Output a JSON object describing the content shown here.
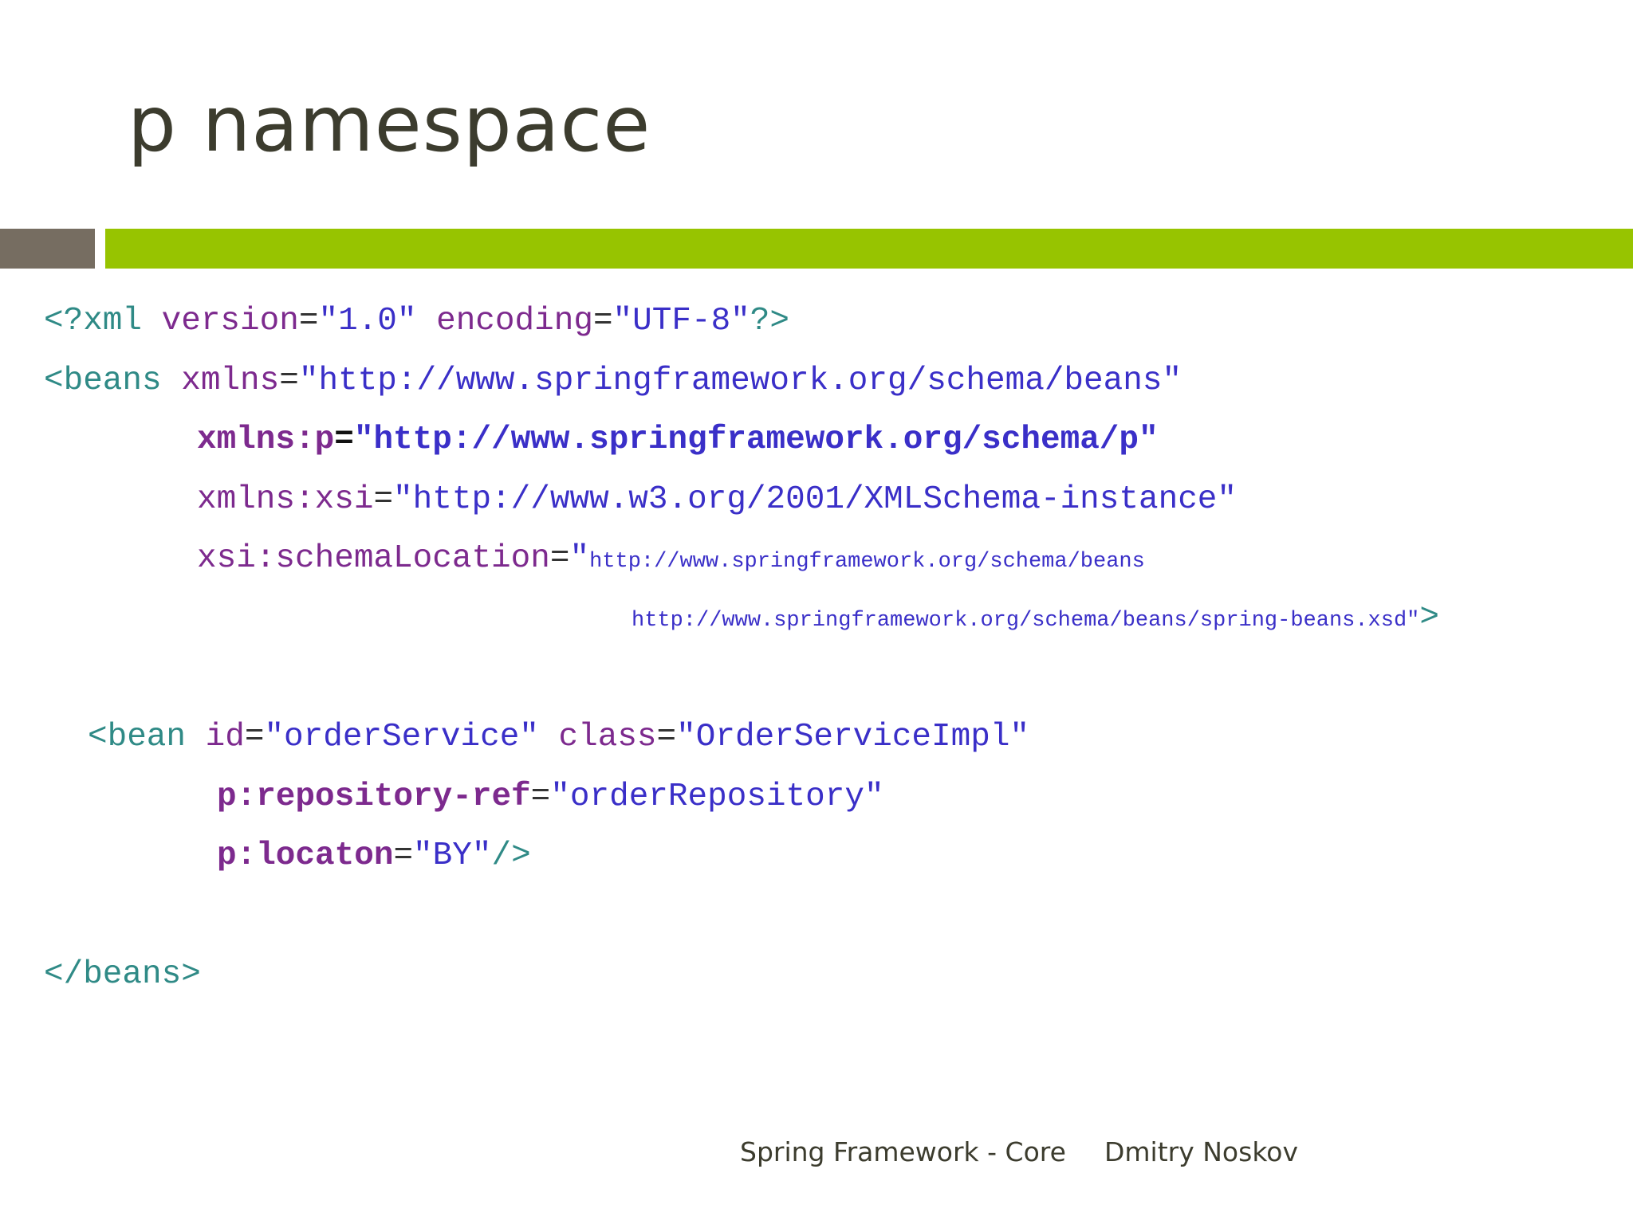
{
  "slide": {
    "title": "p namespace"
  },
  "code": {
    "l1": {
      "a": "<?xml ",
      "b": "version",
      "c": "=",
      "d": "\"1.0\" ",
      "e": "encoding",
      "f": "=",
      "g": "\"UTF-8\"",
      "h": "?>"
    },
    "l2": {
      "a": "<beans ",
      "b": "xmlns",
      "c": "=",
      "d": "\"http://www.springframework.org/schema/beans\""
    },
    "l3": {
      "a": "xmlns:p",
      "b": "=",
      "c": "\"http://www.springframework.org/schema/p\""
    },
    "l4": {
      "a": "xmlns:xsi",
      "b": "=",
      "c": "\"http://www.w3.org/2001/XMLSchema-instance\""
    },
    "l5": {
      "a": "xsi:schemaLocation",
      "b": "=",
      "c": "\"",
      "d": "http://www.springframework.org/schema/beans"
    },
    "l6": {
      "a": "http://www.springframework.org/schema/beans/spring-beans.xsd\"",
      "b": ">"
    },
    "l7": {
      "a": "<bean ",
      "b": "id",
      "c": "=",
      "d": "\"orderService\" ",
      "e": "class",
      "f": "=",
      "g": "\"OrderServiceImpl\""
    },
    "l8": {
      "a": "p:repository-ref",
      "b": "=",
      "c": "\"orderRepository\""
    },
    "l9": {
      "a": "p:locaton",
      "b": "=",
      "c": "\"BY\"",
      "d": "/>"
    },
    "l10": {
      "a": "</beans>"
    }
  },
  "footer": {
    "course": "Spring Framework - Core",
    "author": "Dmitry Noskov"
  }
}
